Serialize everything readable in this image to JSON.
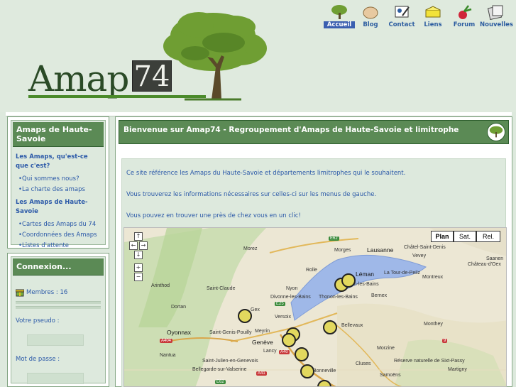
{
  "logo": {
    "name": "Amap",
    "number": "74"
  },
  "nav": [
    {
      "label": "Accueil",
      "icon": "tree-icon",
      "active": true
    },
    {
      "label": "Blog",
      "icon": "egg-icon"
    },
    {
      "label": "Contact",
      "icon": "contact-icon"
    },
    {
      "label": "Liens",
      "icon": "cheese-icon"
    },
    {
      "label": "Forum",
      "icon": "radish-icon"
    },
    {
      "label": "Nouvelles",
      "icon": "newspaper-icon"
    }
  ],
  "sidebar": {
    "title": "Amaps de Haute-Savoie",
    "section1": "Les Amaps, qu'est-ce que c'est?",
    "section1_items": [
      "•Qui sommes nous?",
      "•La charte des amaps"
    ],
    "section2": "Les Amaps de Haute-Savoie",
    "section2_items": [
      "•Cartes des Amaps du 74",
      "•Coordonnées des Amaps",
      "•Listes d'attente"
    ]
  },
  "login": {
    "title": "Connexion...",
    "members": "Membres : 16",
    "pseudo_label": "Votre pseudo :",
    "password_label": "Mot de passe :"
  },
  "main": {
    "title": "Bienvenue sur Amap74 - Regroupement d'Amaps de Haute-Savoie et limitrophe",
    "p1": "Ce site référence les Amaps du Haute-Savoie et départements limitrophes qui le souhaitent.",
    "p2": "Vous trouverez les informations nécessaires sur celles-ci sur les menus de gauche.",
    "p3": "Vous pouvez en trouver une près de chez vous en un clic!"
  },
  "map": {
    "types": [
      "Plan",
      "Sat.",
      "Rel."
    ],
    "active_type": "Plan",
    "places": [
      "Morez",
      "Lausanne",
      "Châtel-Saint-Denis",
      "Morges",
      "Vevey",
      "Saanen",
      "Château-d'Oex",
      "Rolle",
      "Léman",
      "La Tour-de-Peilz",
      "Montreux",
      "Arinthod",
      "Saint-Claude",
      "Divonne-les-Bains",
      "Nyon",
      "Thonon-les-Bains",
      "Evian-les-Bains",
      "Bernex",
      "Dortan",
      "Gex",
      "Versoix",
      "Oyonnax",
      "Saint-Genis-Pouilly",
      "Meyrin",
      "Genève",
      "Bellevaux",
      "Monthey",
      "Nantua",
      "Lancy",
      "Morzine",
      "Saint-Julien-en-Genevois",
      "Bellegarde-sur-Valserine",
      "Bonneville",
      "Cluses",
      "Samoëns",
      "Réserve naturelle de Sixt-Passy",
      "Martigny"
    ],
    "roads": [
      "E62",
      "E25",
      "A404",
      "A40",
      "A41",
      "E62",
      "9"
    ]
  }
}
